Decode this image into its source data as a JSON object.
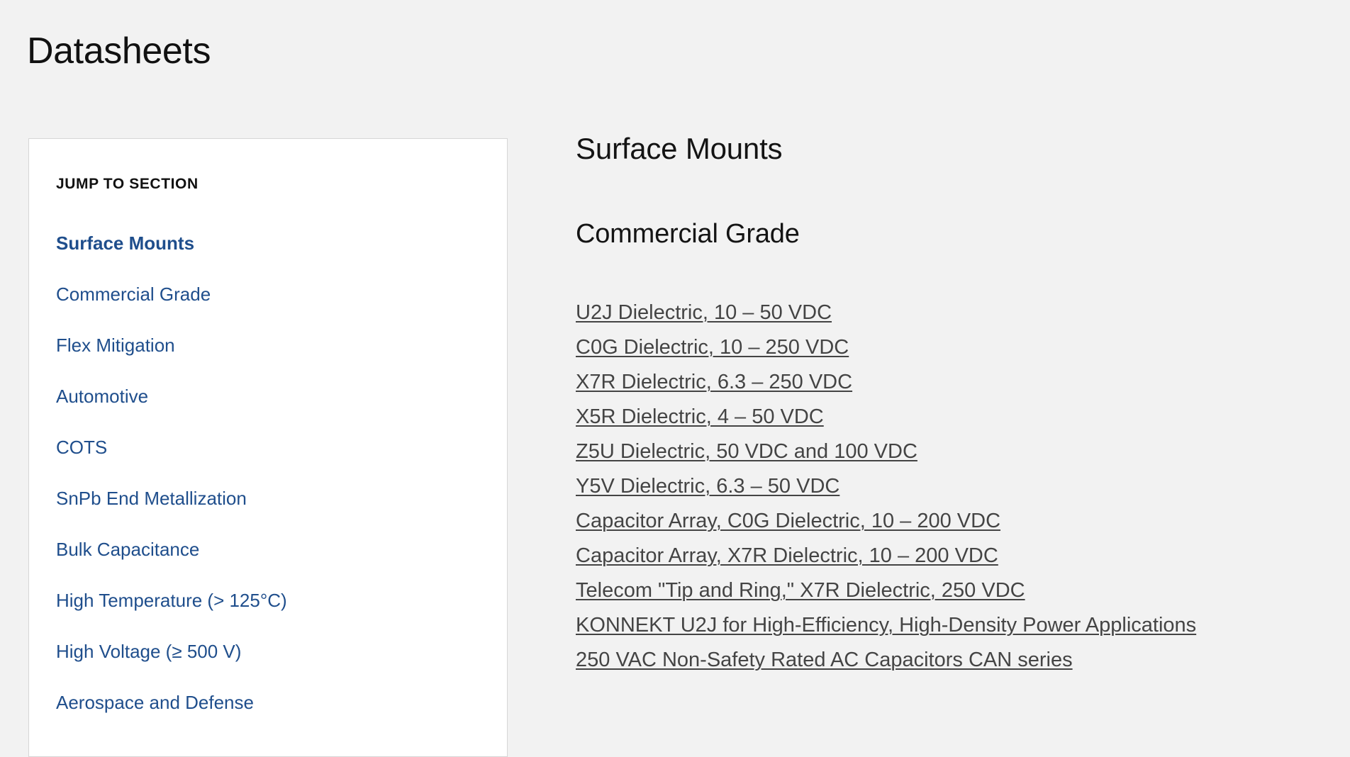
{
  "page": {
    "title": "Datasheets",
    "background_color": "#f2f2f2",
    "link_blue": "#1f4e8c",
    "doc_link_color": "#444444"
  },
  "sidebar": {
    "heading": "JUMP TO SECTION",
    "items": [
      {
        "label": "Surface Mounts",
        "active": true
      },
      {
        "label": "Commercial Grade",
        "active": false
      },
      {
        "label": "Flex Mitigation",
        "active": false
      },
      {
        "label": "Automotive",
        "active": false
      },
      {
        "label": "COTS",
        "active": false
      },
      {
        "label": "SnPb End Metallization",
        "active": false
      },
      {
        "label": "Bulk Capacitance",
        "active": false
      },
      {
        "label": "High Temperature (> 125°C)",
        "active": false
      },
      {
        "label": "High Voltage (≥ 500 V)",
        "active": false
      },
      {
        "label": "Aerospace and Defense",
        "active": false
      }
    ]
  },
  "main": {
    "section_title": "Surface Mounts",
    "subsection_title": "Commercial Grade",
    "documents": [
      "U2J Dielectric, 10 – 50 VDC",
      "C0G Dielectric, 10 – 250 VDC",
      "X7R Dielectric, 6.3 – 250 VDC",
      "X5R Dielectric, 4 – 50 VDC",
      "Z5U Dielectric, 50 VDC and 100 VDC",
      "Y5V Dielectric, 6.3 – 50 VDC",
      "Capacitor Array, C0G Dielectric, 10 – 200 VDC",
      "Capacitor Array, X7R Dielectric, 10 – 200 VDC",
      "Telecom \"Tip and Ring,\" X7R Dielectric, 250 VDC",
      "KONNEKT U2J for High-Efficiency, High-Density Power Applications",
      "250 VAC Non-Safety Rated AC Capacitors CAN series"
    ]
  }
}
